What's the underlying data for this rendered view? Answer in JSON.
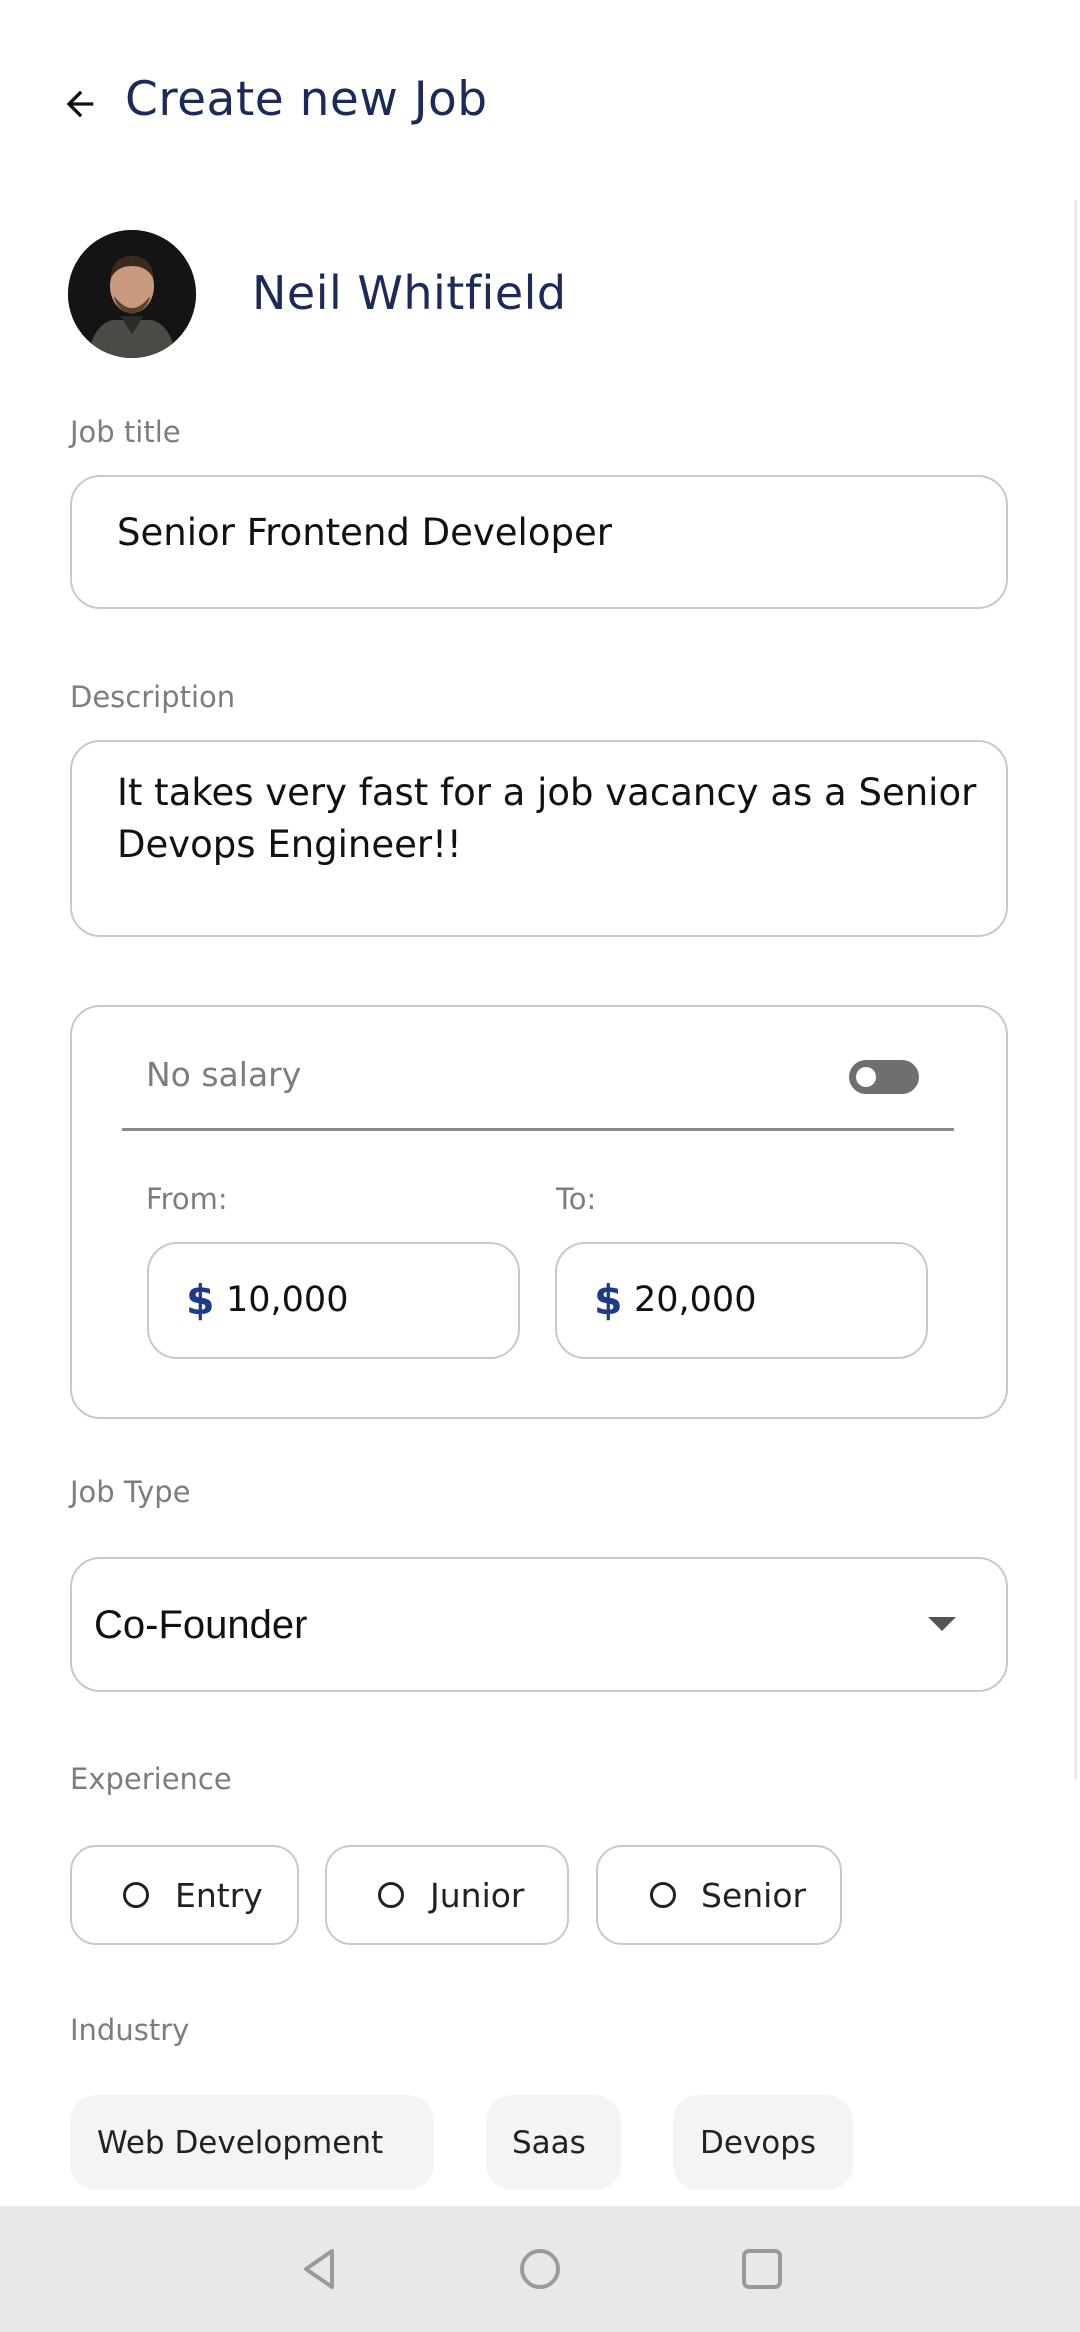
{
  "header": {
    "title": "Create new Job",
    "back_icon": "arrow-left-icon"
  },
  "profile": {
    "name": "Neil Whitfield"
  },
  "job_title": {
    "label": "Job title",
    "value": "Senior Frontend Developer"
  },
  "description": {
    "label": "Description",
    "value": "It takes very fast for a job vacancy as a Senior Devops Engineer!!"
  },
  "salary": {
    "no_salary_label": "No salary",
    "no_salary_enabled": false,
    "from_label": "From:",
    "to_label": "To:",
    "currency_symbol": "$",
    "from_value": "10,000",
    "to_value": "20,000"
  },
  "job_type": {
    "label": "Job Type",
    "selected": "Co-Founder"
  },
  "experience": {
    "label": "Experience",
    "options": [
      {
        "label": "Entry",
        "selected": false
      },
      {
        "label": "Junior",
        "selected": false
      },
      {
        "label": "Senior",
        "selected": false
      }
    ]
  },
  "industry": {
    "label": "Industry",
    "tags": [
      "Web Development",
      "Saas",
      "Devops"
    ]
  },
  "colors": {
    "title": "#1c2a5b",
    "currency": "#1e3a8a",
    "border": "#c9c9c9",
    "label": "#7d7d7d",
    "navbar": "#e8e8e8"
  }
}
